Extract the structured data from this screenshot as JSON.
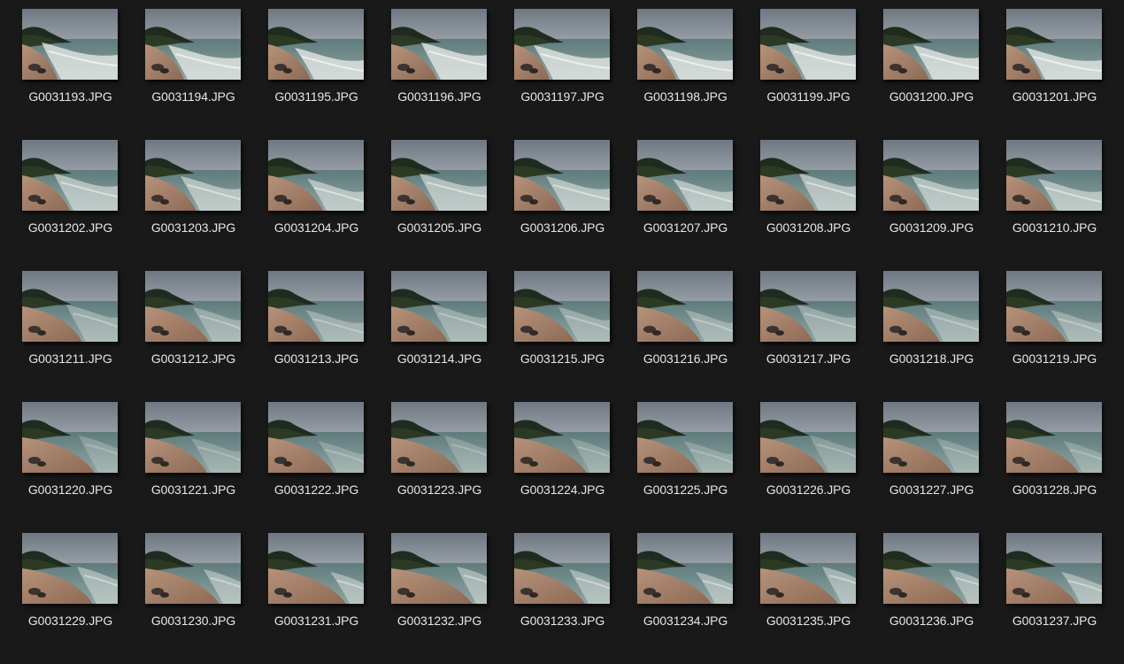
{
  "view": "large-icons",
  "colors": {
    "background": "#191919",
    "label_text": "#e6e6e6"
  },
  "files": [
    "G0031193.JPG",
    "G0031194.JPG",
    "G0031195.JPG",
    "G0031196.JPG",
    "G0031197.JPG",
    "G0031198.JPG",
    "G0031199.JPG",
    "G0031200.JPG",
    "G0031201.JPG",
    "G0031202.JPG",
    "G0031203.JPG",
    "G0031204.JPG",
    "G0031205.JPG",
    "G0031206.JPG",
    "G0031207.JPG",
    "G0031208.JPG",
    "G0031209.JPG",
    "G0031210.JPG",
    "G0031211.JPG",
    "G0031212.JPG",
    "G0031213.JPG",
    "G0031214.JPG",
    "G0031215.JPG",
    "G0031216.JPG",
    "G0031217.JPG",
    "G0031218.JPG",
    "G0031219.JPG",
    "G0031220.JPG",
    "G0031221.JPG",
    "G0031222.JPG",
    "G0031223.JPG",
    "G0031224.JPG",
    "G0031225.JPG",
    "G0031226.JPG",
    "G0031227.JPG",
    "G0031228.JPG",
    "G0031229.JPG",
    "G0031230.JPG",
    "G0031231.JPG",
    "G0031232.JPG",
    "G0031233.JPG",
    "G0031234.JPG",
    "G0031235.JPG",
    "G0031236.JPG",
    "G0031237.JPG"
  ]
}
